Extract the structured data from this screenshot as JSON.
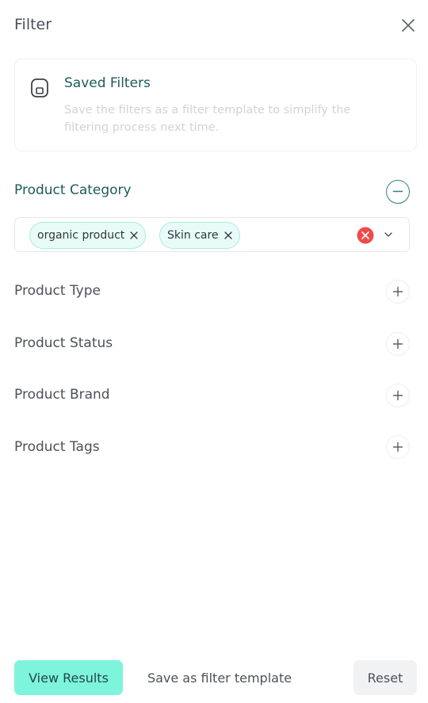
{
  "header": {
    "title": "Filter",
    "close_icon": "close-icon"
  },
  "saved_filters": {
    "title": "Saved Filters",
    "description": "Save the filters as a filter template to simplify the filtering process next time.",
    "icon": "save-floppy-icon"
  },
  "category": {
    "label": "Product Category",
    "expanded": true,
    "chips": [
      {
        "label": "organic product"
      },
      {
        "label": "Skin care"
      }
    ]
  },
  "sections": [
    {
      "label": "Product Type"
    },
    {
      "label": "Product Status"
    },
    {
      "label": "Product Brand"
    },
    {
      "label": "Product Tags"
    }
  ],
  "footer": {
    "view_results": "View Results",
    "save_template": "Save as filter template",
    "reset": "Reset"
  },
  "colors": {
    "accent": "#7ef4dc",
    "brand_text": "#1d5a5f",
    "chip_bg": "#e9fbf6",
    "chip_border": "#a6ece0",
    "clear_red": "#ee4c4c"
  }
}
